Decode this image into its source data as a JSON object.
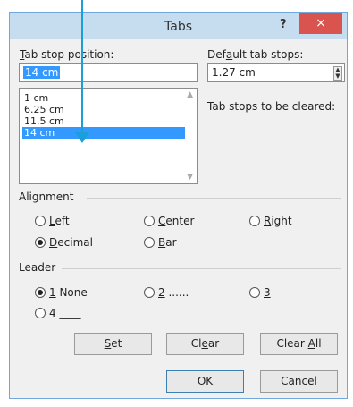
{
  "dialog": {
    "title": "Tabs",
    "help_label": "?",
    "close_label": "×"
  },
  "tab_stop": {
    "label_first": "T",
    "label_rest": "ab stop position:",
    "value": "14 cm",
    "list": [
      "1 cm",
      "6.25 cm",
      "11.5 cm",
      "14 cm"
    ],
    "selected_index": 3
  },
  "default_tabs": {
    "label_first": "Def",
    "label_u": "a",
    "label_rest": "ult tab stops:",
    "value": "1.27 cm",
    "to_be_cleared_label": "Tab stops to be cleared:"
  },
  "alignment": {
    "title": "Alignment",
    "options": [
      {
        "u": "L",
        "rest": "eft",
        "checked": false
      },
      {
        "u": "C",
        "rest": "enter",
        "checked": false
      },
      {
        "u": "R",
        "rest": "ight",
        "checked": false
      },
      {
        "u": "D",
        "rest": "ecimal",
        "checked": true
      },
      {
        "u": "B",
        "rest": "ar",
        "checked": false
      }
    ]
  },
  "leader": {
    "title": "Leader",
    "options": [
      {
        "u": "1",
        "rest": " None",
        "checked": true
      },
      {
        "u": "2",
        "rest": " ......",
        "checked": false
      },
      {
        "u": "3",
        "rest": " -------",
        "checked": false
      },
      {
        "u": "4",
        "rest": " ____",
        "checked": false
      }
    ]
  },
  "buttons": {
    "set_u": "S",
    "set_rest": "et",
    "clear_pre": "Cl",
    "clear_u": "e",
    "clear_rest": "ar",
    "clear_all_pre": "Clear ",
    "clear_all_u": "A",
    "clear_all_rest": "ll",
    "ok": "OK",
    "cancel": "Cancel"
  },
  "colors": {
    "titlebar": "#c6dcef",
    "close": "#d9544f",
    "selection": "#3399ff",
    "pointer": "#1aa0d8"
  },
  "icons": {
    "spinner": "up-down-spinner-icon",
    "scroll_up": "scroll-up-icon",
    "scroll_down": "scroll-down-icon"
  }
}
